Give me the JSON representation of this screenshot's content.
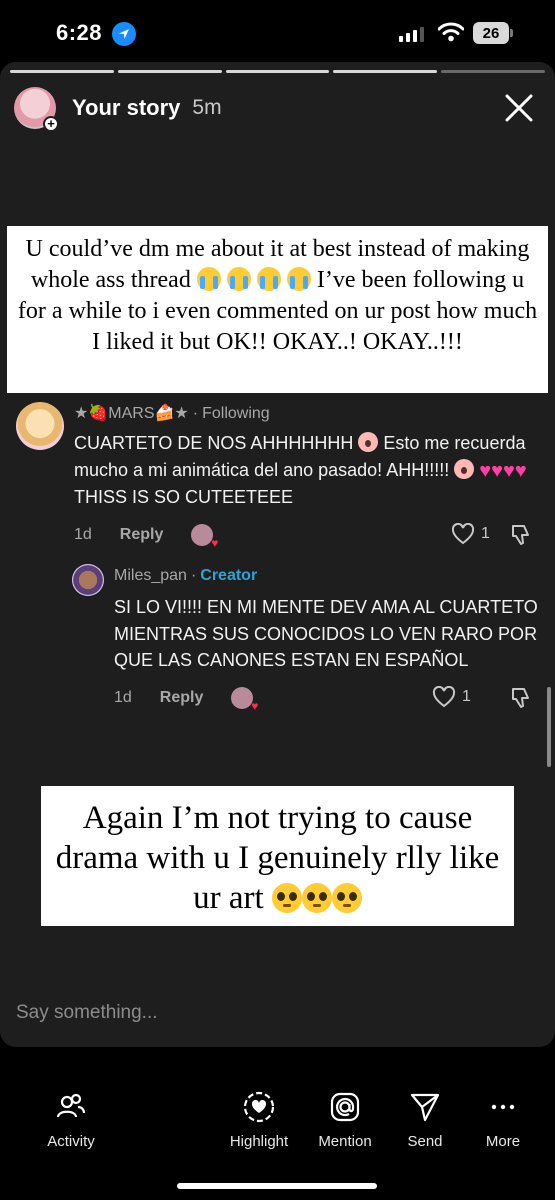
{
  "status_bar": {
    "time": "6:28",
    "battery": "26"
  },
  "story": {
    "name": "Your story",
    "age": "5m",
    "progress_segments": 5,
    "progress_done": 4,
    "caption_top": "U could’ve dm me about it at best instead of making whole ass thread",
    "caption_top_rest": "I’ve been following u for a while to i even commented on ur post how much I liked it but OK!! OKAY..! OKAY..!!!",
    "caption_bottom": "Again I’m not trying to cause drama with u I genuinely rlly like ur art"
  },
  "comments": [
    {
      "user": "★🍓MARS🍰★",
      "relation": "Following",
      "text_a": "CUARTETO DE NOS AHHHHHHH",
      "text_b": "Esto me recuerda mucho a mi animática del ano pasado! AHH!!!!!",
      "text_c": "THISS IS SO CUTEETEEE",
      "age": "1d",
      "reply_label": "Reply",
      "likes": "1"
    },
    {
      "user": "Miles_pan",
      "relation": "Creator",
      "text": "SI LO VI!!!! EN MI MENTE DEV AMA AL CUARTETO MIENTRAS SUS CONOCIDOS LO VEN RARO POR QUE LAS CANONES ESTAN EN ESPAÑOL",
      "age": "1d",
      "reply_label": "Reply",
      "likes": "1"
    }
  ],
  "composer": {
    "placeholder": "Say something..."
  },
  "toolbar": {
    "activity": "Activity",
    "highlight": "Highlight",
    "mention": "Mention",
    "send": "Send",
    "more": "More"
  }
}
